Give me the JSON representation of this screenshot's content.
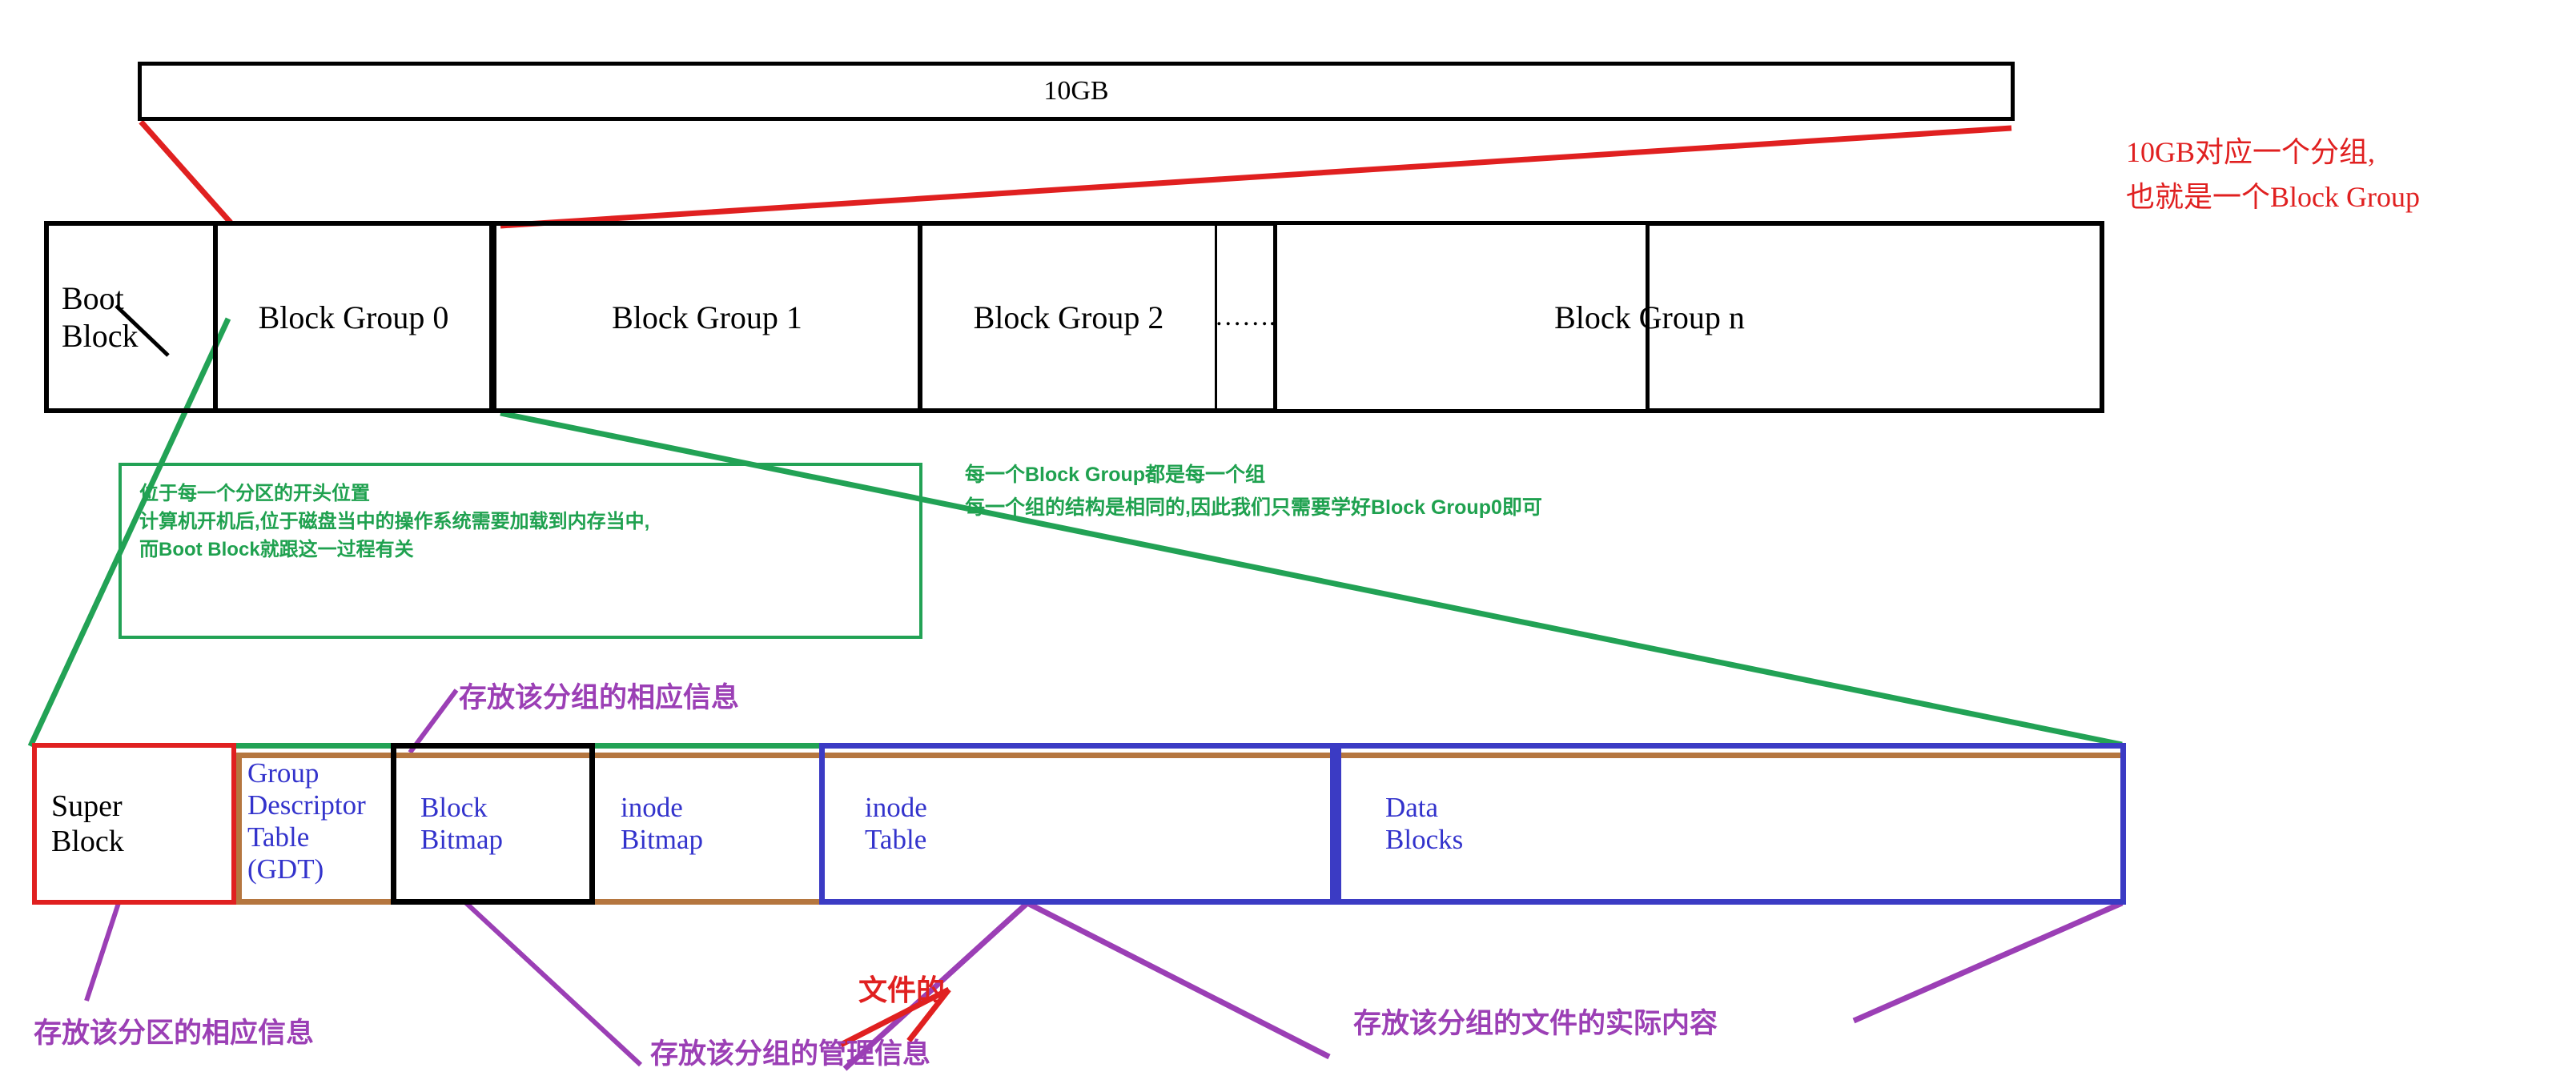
{
  "diagram": {
    "title_bar": {
      "label": "10GB"
    },
    "partition": {
      "boot_block": "Boot\nBlock",
      "groups": [
        {
          "label": "Block Group 0"
        },
        {
          "label": "Block Group 1"
        },
        {
          "label": "Block Group 2"
        },
        {
          "label": "……."
        },
        {
          "label": "Block Group n"
        }
      ]
    },
    "structure": {
      "blocks": [
        {
          "label": "Super\nBlock",
          "color": "#e02020"
        },
        {
          "label": "Group\nDescriptor\nTable\n(GDT)",
          "color": "#b5763f"
        },
        {
          "label": "Block\nBitmap",
          "color": "#000000"
        },
        {
          "label": "inode\nBitmap",
          "color": "#b5763f"
        },
        {
          "label": "inode\nTable",
          "color": "#3b3bc4"
        },
        {
          "label": "Data\nBlocks",
          "color": "#3b3bc4"
        }
      ]
    },
    "annotations": {
      "red_right": "10GB对应一个分组,\n也就是一个Block Group",
      "green_boot_box": "位于每一个分区的开头位置\n计算机开机后,位于磁盘当中的操作系统需要加载到内存当中,\n而Boot Block就跟这一过程有关",
      "green_right": "每一个Block Group都是每一个组\n每一个组的结构是相同的,因此我们只需要学好Block Group0即可",
      "purple_gdt_top": "存放该分组的相应信息",
      "purple_super": "存放该分区的相应信息",
      "purple_gdt_bottom": "存放该分组的管理信息",
      "red_file": "文件的",
      "purple_data": "存放该分组的文件的实际内容"
    },
    "colors": {
      "red": "#e02020",
      "green": "#22a255",
      "purple": "#9b3fb5",
      "blue": "#3333cc",
      "tan": "#b5763f",
      "black": "#000000"
    }
  }
}
